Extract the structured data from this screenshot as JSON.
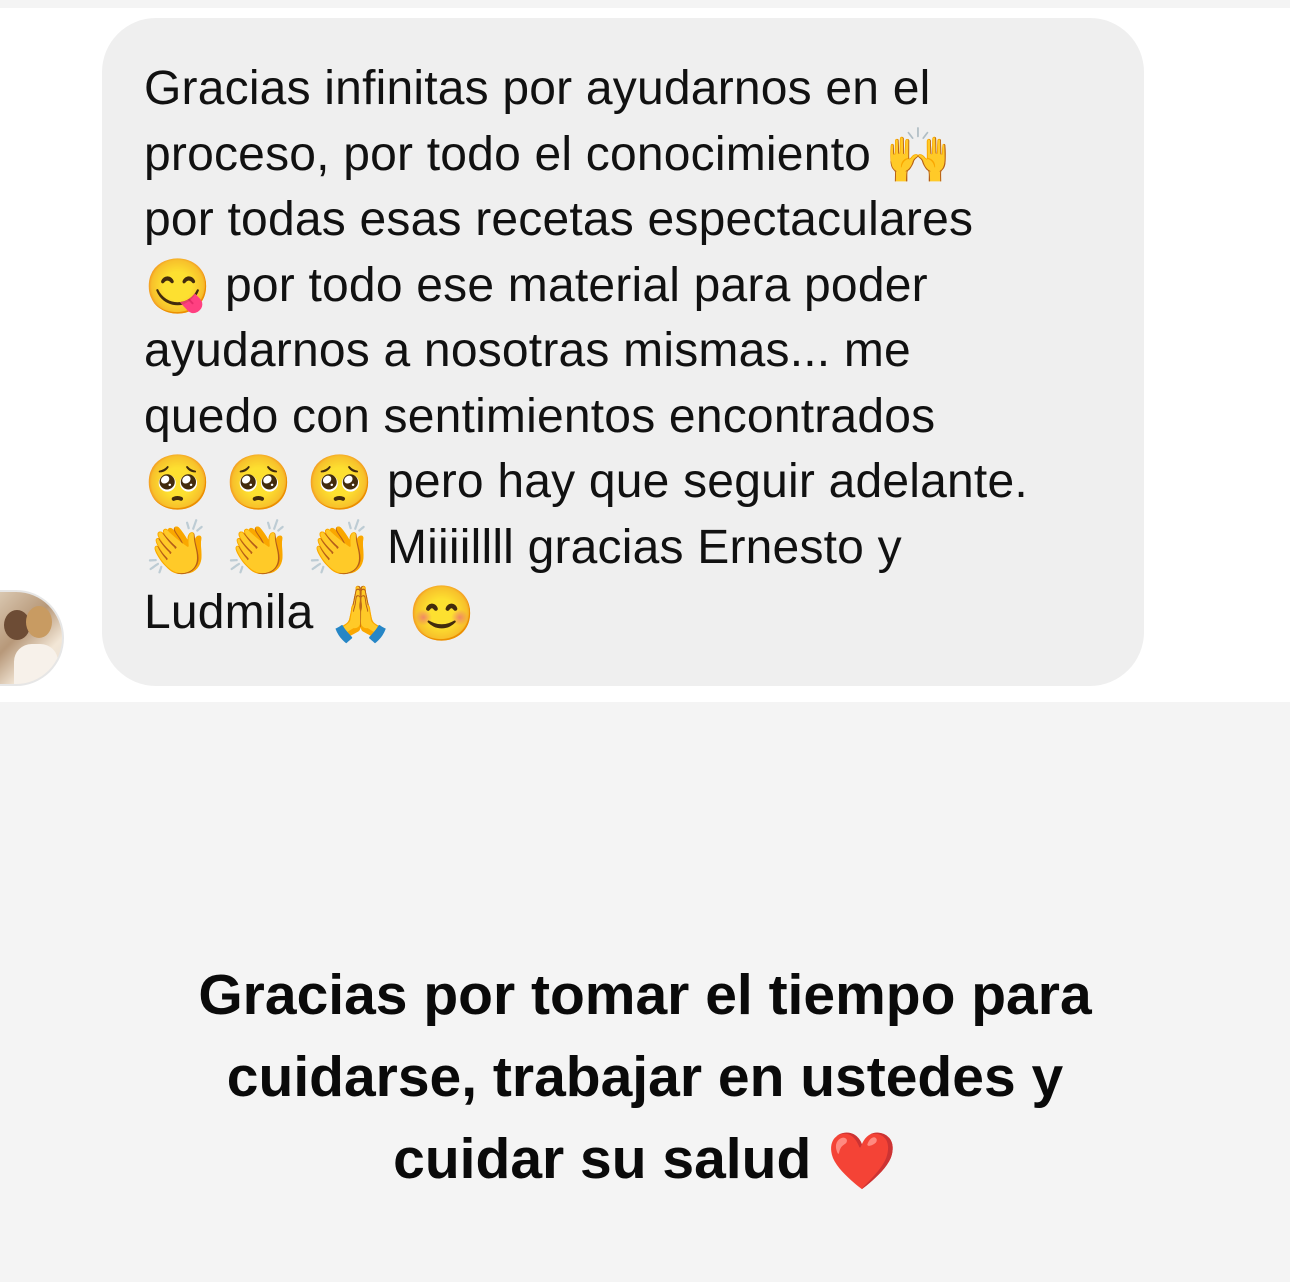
{
  "message": {
    "text": "Gracias infinitas por ayudarnos en el proceso, por todo el conocimiento 🙌 por todas esas recetas espectaculares 😋 por todo ese material para poder ayudarnos a nosotras mismas... me quedo con sentimientos encontrados 🥺 🥺 🥺 pero hay que seguir adelante. 👏 👏 👏 Miiiillll gracias Ernesto y Ludmila 🙏 😊",
    "lines": [
      "Gracias infinitas por ayudarnos en el",
      "proceso, por todo el conocimiento",
      "por todas esas recetas espectaculares",
      " por todo ese material para poder",
      "ayudarnos a nosotras mismas... me",
      "quedo con sentimientos encontrados",
      " pero hay que seguir adelante.",
      " Miiiillll gracias Ernesto y",
      "Ludmila"
    ],
    "emojis": {
      "raising_hands": "🙌",
      "yum": "😋",
      "pleading": "🥺",
      "clap": "👏",
      "pray": "🙏",
      "smile": "😊"
    }
  },
  "caption": {
    "line1": "Gracias por tomar el tiempo para",
    "line2": "cuidarse, trabajar en ustedes y",
    "line3": "cuidar su salud",
    "heart": "❤️"
  }
}
